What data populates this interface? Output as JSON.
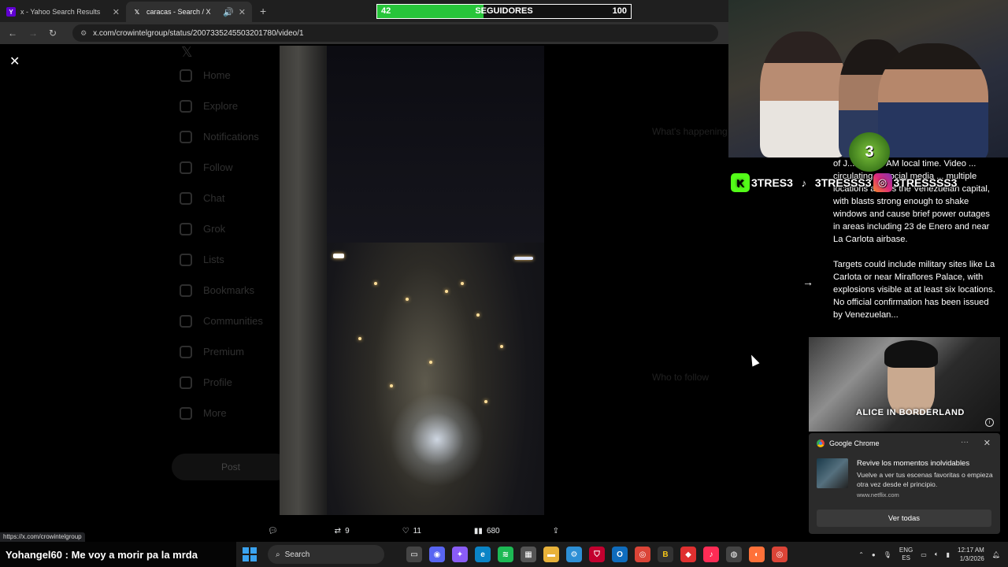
{
  "browser": {
    "tabs": [
      {
        "title": "x - Yahoo Search Results",
        "favicon": "yahoo-icon",
        "active": false
      },
      {
        "title": "caracas - Search / X",
        "favicon": "x-logo-icon",
        "active": true
      }
    ],
    "address": "x.com/crowintelgroup/status/2007335245503201780/video/1"
  },
  "x_nav": [
    "Home",
    "Explore",
    "Notifications",
    "Follow",
    "Chat",
    "Grok",
    "Lists",
    "Bookmarks",
    "Communities",
    "Premium",
    "Profile",
    "More"
  ],
  "x_post_button": "Post",
  "x_sidebar": {
    "whats_happening": "What's happening",
    "who_to_follow": "Who to follow"
  },
  "post_actions": {
    "replies": "",
    "reposts": "9",
    "likes": "11",
    "views": "680"
  },
  "status_url": "https://x.com/crowintelgroup",
  "follower_goal": {
    "current": "42",
    "label": "SEGUIDORES",
    "target": "100",
    "progress": 0.42,
    "fill_color": "#27c53a"
  },
  "caption": {
    "p1": "of J... at 2:00 AM local time. Video ... circulating ... social media ... multiple locations across the Venezuelan capital, with blasts strong enough to shake windows and cause brief power outages in areas including 23 de Enero and near La Carlota airbase.",
    "p2": "Targets could include military sites like La Carlota or near Miraflores Palace, with explosions visible at at least six locations. No official confirmation has been issued by Venezuelan..."
  },
  "socials": {
    "logo_text": "3",
    "kick": "3TRES3",
    "tiktok": "3TRESSS3",
    "instagram": "3TRESSSS3"
  },
  "ad": {
    "title": "ALICE IN BORDERLAND"
  },
  "notification": {
    "app": "Google Chrome",
    "title": "Revive los momentos inolvidables",
    "body": "Vuelve a ver tus escenas favoritas o empieza otra vez desde el principio.",
    "url": "www.netflix.com",
    "button": "Ver todas"
  },
  "chat_message": {
    "user": "Yohangel60",
    "text": "Me voy a morir pa la mrda"
  },
  "taskbar": {
    "search": "Search",
    "lang1": "ENG",
    "lang2": "ES",
    "time": "12:17 AM",
    "date": "1/3/2026"
  }
}
